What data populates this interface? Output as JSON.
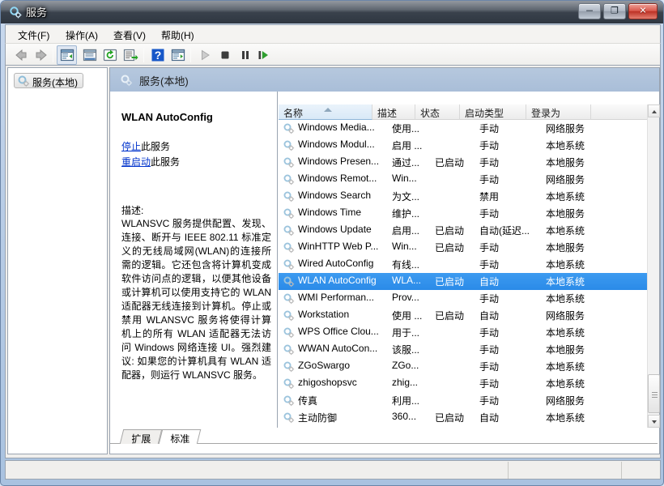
{
  "window": {
    "title": "服务",
    "title_icon": "services-gear-icon",
    "controls": {
      "minimize": "─",
      "maximize": "❐",
      "close": "✕"
    }
  },
  "menubar": {
    "items": [
      {
        "label": "文件(F)",
        "name": "menu-file"
      },
      {
        "label": "操作(A)",
        "name": "menu-action"
      },
      {
        "label": "查看(V)",
        "name": "menu-view"
      },
      {
        "label": "帮助(H)",
        "name": "menu-help"
      }
    ]
  },
  "toolbar": {
    "buttons": [
      {
        "name": "back-arrow-icon",
        "title": "后退"
      },
      {
        "name": "forward-arrow-icon",
        "title": "前进"
      },
      {
        "name": "show-tree-icon",
        "title": "显示/隐藏控制台树"
      },
      {
        "name": "properties-icon",
        "title": "属性"
      },
      {
        "name": "refresh-icon",
        "title": "刷新"
      },
      {
        "name": "export-list-icon",
        "title": "导出列表"
      },
      {
        "name": "help-icon",
        "title": "帮助"
      },
      {
        "name": "show-pane-icon",
        "title": "显示/隐藏操作窗格"
      },
      {
        "name": "start-service-icon",
        "title": "启动服务"
      },
      {
        "name": "stop-service-icon",
        "title": "停止服务"
      },
      {
        "name": "pause-service-icon",
        "title": "暂停服务"
      },
      {
        "name": "restart-service-icon",
        "title": "重启服务"
      }
    ]
  },
  "tree": {
    "root_label": "服务(本地)"
  },
  "right_pane": {
    "header_label": "服务(本地)"
  },
  "detail": {
    "service_title": "WLAN AutoConfig",
    "stop_link": "停止",
    "stop_suffix": "此服务",
    "restart_link": "重启动",
    "restart_suffix": "此服务",
    "description_label": "描述:",
    "description_body": "WLANSVC 服务提供配置、发现、连接、断开与 IEEE 802.11 标准定义的无线局域网(WLAN)的连接所需的逻辑。它还包含将计算机变成软件访问点的逻辑，以便其他设备或计算机可以使用支持它的 WLAN 适配器无线连接到计算机。停止或禁用 WLANSVC 服务将使得计算机上的所有 WLAN 适配器无法访问 Windows 网络连接 UI。强烈建议: 如果您的计算机具有 WLAN 适配器，则运行 WLANSVC 服务。"
  },
  "list": {
    "columns": [
      {
        "label": "名称",
        "name": "column-name",
        "sorted": true,
        "sort_dir": "asc"
      },
      {
        "label": "描述",
        "name": "column-description",
        "sorted": false
      },
      {
        "label": "状态",
        "name": "column-status",
        "sorted": false
      },
      {
        "label": "启动类型",
        "name": "column-startup-type",
        "sorted": false
      },
      {
        "label": "登录为",
        "name": "column-log-on-as",
        "sorted": false
      }
    ],
    "rows": [
      {
        "name": "Windows Media...",
        "description": "使用...",
        "status": "",
        "startup": "手动",
        "logon": "网络服务",
        "selected": false
      },
      {
        "name": "Windows Modul...",
        "description": "启用 ...",
        "status": "",
        "startup": "手动",
        "logon": "本地系统",
        "selected": false
      },
      {
        "name": "Windows Presen...",
        "description": "通过...",
        "status": "已启动",
        "startup": "手动",
        "logon": "本地服务",
        "selected": false
      },
      {
        "name": "Windows Remot...",
        "description": "Win...",
        "status": "",
        "startup": "手动",
        "logon": "网络服务",
        "selected": false
      },
      {
        "name": "Windows Search",
        "description": "为文...",
        "status": "",
        "startup": "禁用",
        "logon": "本地系统",
        "selected": false
      },
      {
        "name": "Windows Time",
        "description": "维护...",
        "status": "",
        "startup": "手动",
        "logon": "本地服务",
        "selected": false
      },
      {
        "name": "Windows Update",
        "description": "启用...",
        "status": "已启动",
        "startup": "自动(延迟...",
        "logon": "本地系统",
        "selected": false
      },
      {
        "name": "WinHTTP Web P...",
        "description": "Win...",
        "status": "已启动",
        "startup": "手动",
        "logon": "本地服务",
        "selected": false
      },
      {
        "name": "Wired AutoConfig",
        "description": "有线...",
        "status": "",
        "startup": "手动",
        "logon": "本地系统",
        "selected": false
      },
      {
        "name": "WLAN AutoConfig",
        "description": "WLA...",
        "status": "已启动",
        "startup": "自动",
        "logon": "本地系统",
        "selected": true
      },
      {
        "name": "WMI Performan...",
        "description": "Prov...",
        "status": "",
        "startup": "手动",
        "logon": "本地系统",
        "selected": false
      },
      {
        "name": "Workstation",
        "description": "使用 ...",
        "status": "已启动",
        "startup": "自动",
        "logon": "网络服务",
        "selected": false
      },
      {
        "name": "WPS Office Clou...",
        "description": "用于...",
        "status": "",
        "startup": "手动",
        "logon": "本地系统",
        "selected": false
      },
      {
        "name": "WWAN AutoCon...",
        "description": "该服...",
        "status": "",
        "startup": "手动",
        "logon": "本地服务",
        "selected": false
      },
      {
        "name": "ZGoSwargo",
        "description": "ZGo...",
        "status": "",
        "startup": "手动",
        "logon": "本地系统",
        "selected": false
      },
      {
        "name": "zhigoshopsvc",
        "description": "zhig...",
        "status": "",
        "startup": "手动",
        "logon": "本地系统",
        "selected": false
      },
      {
        "name": "传真",
        "description": "利用...",
        "status": "",
        "startup": "手动",
        "logon": "网络服务",
        "selected": false
      },
      {
        "name": "主动防御",
        "description": "360...",
        "status": "已启动",
        "startup": "自动",
        "logon": "本地系统",
        "selected": false
      }
    ]
  },
  "tabs": [
    {
      "label": "扩展",
      "name": "tab-extended",
      "active": false
    },
    {
      "label": "标准",
      "name": "tab-standard",
      "active": true
    }
  ],
  "statusbar": {
    "text": ""
  },
  "colors": {
    "selection": "#2a8ae8",
    "header_band": "#a9bed8",
    "link": "#0033cc",
    "close_button": "#bb2f23"
  }
}
